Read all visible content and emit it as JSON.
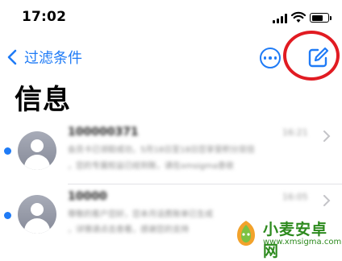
{
  "status_bar": {
    "time": "17:02",
    "icons": [
      "signal-icon",
      "wifi-icon",
      "battery-icon"
    ],
    "battery_level": 0.7
  },
  "nav": {
    "back_label": "过滤条件",
    "more_icon": "ellipsis-circle-icon",
    "compose_icon": "compose-icon"
  },
  "page": {
    "title": "信息"
  },
  "messages": [
    {
      "sender": "100000371",
      "time": "16:21",
      "preview_line1": "会员卡已领取成功，5月18日至18日您享受积分双倍",
      "preview_line2": "，您的专属权益已经到账，请在xmsigma查收",
      "unread": true
    },
    {
      "sender": "10000",
      "time": "16:05",
      "preview_line1": "尊敬的客户您好，您本月话费账单已生成",
      "preview_line2": "，详情请点击查看，感谢您的支持",
      "unread": true
    }
  ],
  "colors": {
    "accent": "#1f7bf6",
    "highlight_ring": "#e11b22",
    "watermark": "#2d8a1e"
  },
  "watermark": {
    "title": "小麦安卓网",
    "url": "www.xmsigma.com"
  }
}
